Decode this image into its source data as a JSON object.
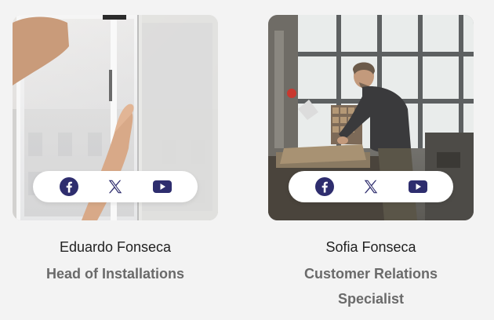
{
  "members": [
    {
      "name": "Eduardo Fonseca",
      "role": "Head of Installations",
      "social": [
        "facebook-icon",
        "x-icon",
        "youtube-icon"
      ]
    },
    {
      "name": "Sofia Fonseca",
      "role": "Customer Relations Specialist",
      "social": [
        "facebook-icon",
        "x-icon",
        "youtube-icon"
      ]
    }
  ],
  "colors": {
    "icon": "#2e2d6e",
    "background": "#f3f3f3",
    "name": "#222222",
    "role": "#6a6a6a"
  }
}
